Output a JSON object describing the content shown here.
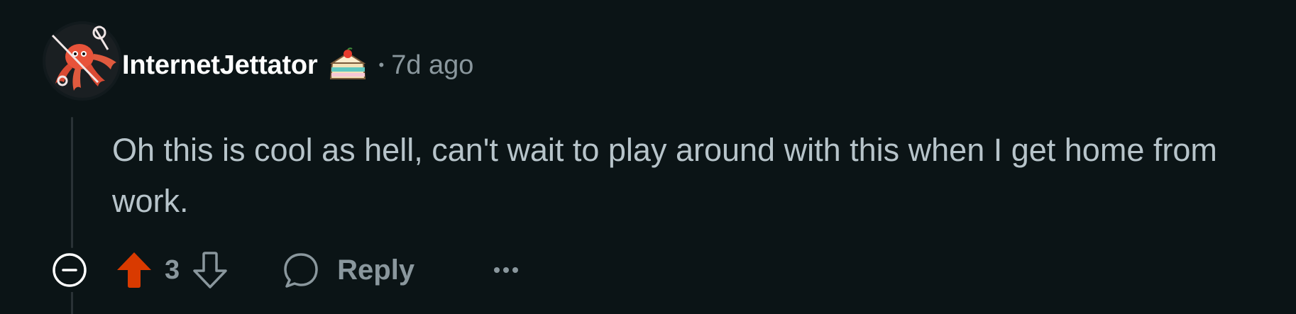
{
  "comment": {
    "author": "InternetJettator",
    "separator": "•",
    "timestamp": "7d ago",
    "body": "Oh this is cool as hell, can't wait to play around with this when I get home from work.",
    "badge_icon": "cake-day-icon",
    "avatar_icon": "octopus-avatar"
  },
  "actions": {
    "collapse_icon": "minus-circle-icon",
    "upvote_icon": "upvote-arrow-icon",
    "vote_count": "3",
    "downvote_icon": "downvote-arrow-icon",
    "reply_icon": "speech-bubble-icon",
    "reply_label": "Reply",
    "more_icon": "ellipsis-icon"
  },
  "colors": {
    "background": "#0b1416",
    "upvote_active": "#d93a00",
    "muted_text": "#8a979d",
    "body_text": "#b7c4ca",
    "username": "#ffffff"
  }
}
